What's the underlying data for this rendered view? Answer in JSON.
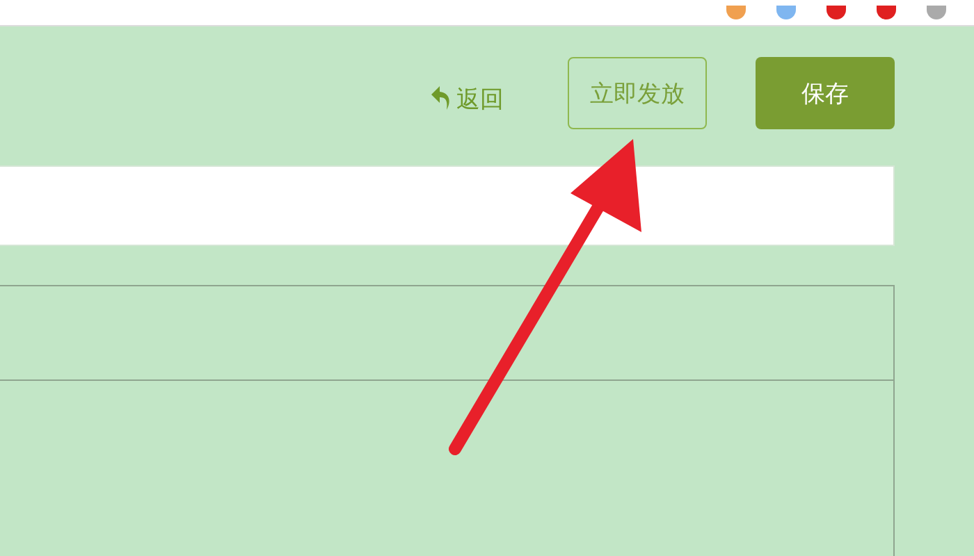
{
  "toolbar": {
    "back_link": "返回",
    "publish_button": "立即发放",
    "save_button": "保存"
  }
}
